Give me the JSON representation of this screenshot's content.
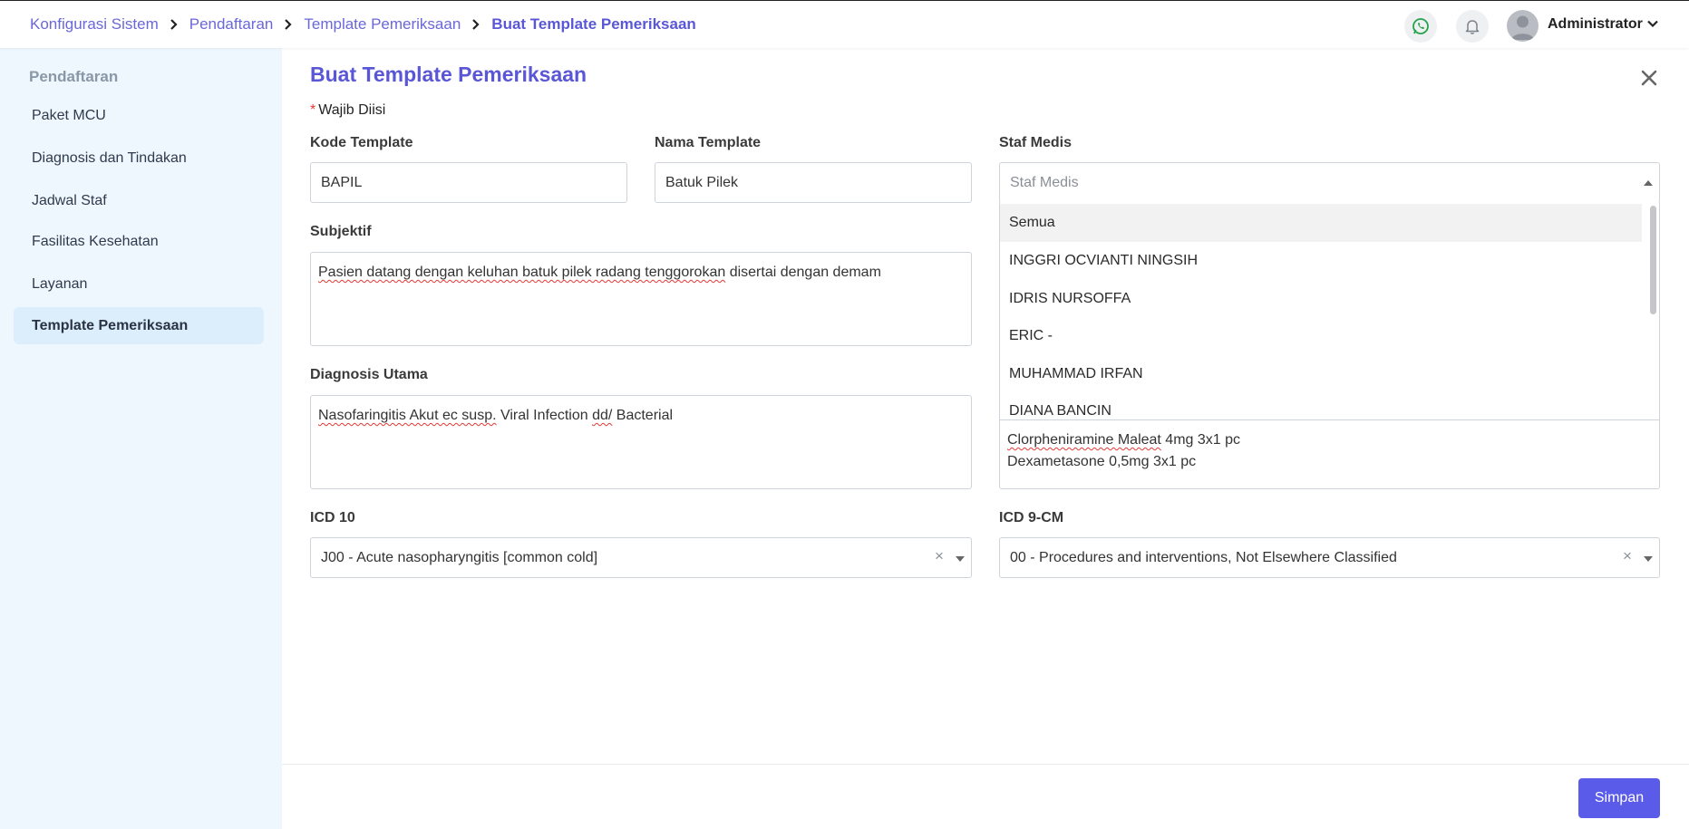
{
  "breadcrumb": [
    {
      "label": "Konfigurasi Sistem"
    },
    {
      "label": "Pendaftaran"
    },
    {
      "label": "Template Pemeriksaan"
    },
    {
      "label": "Buat Template Pemeriksaan"
    }
  ],
  "header": {
    "user_name": "Administrator",
    "whatsapp_icon": "whatsapp-icon",
    "bell_icon": "bell-icon",
    "accent_color": "#5a57d6"
  },
  "sidebar": {
    "heading": "Pendaftaran",
    "items": [
      {
        "label": "Paket MCU"
      },
      {
        "label": "Diagnosis dan Tindakan"
      },
      {
        "label": "Jadwal Staf"
      },
      {
        "label": "Fasilitas Kesehatan"
      },
      {
        "label": "Layanan"
      },
      {
        "label": "Template Pemeriksaan",
        "active": true
      }
    ]
  },
  "form": {
    "title": "Buat Template Pemeriksaan",
    "required_note": "Wajib Diisi",
    "kode_template": {
      "label": "Kode Template",
      "value": "BAPIL"
    },
    "nama_template": {
      "label": "Nama Template",
      "value": "Batuk Pilek"
    },
    "staf_medis": {
      "label": "Staf Medis",
      "placeholder": "Staf Medis",
      "options": [
        "Semua",
        "INGGRI OCVIANTI NINGSIH",
        "IDRIS NURSOFFA",
        "ERIC -",
        "MUHAMMAD IRFAN",
        "DIANA BANCIN"
      ]
    },
    "subjektif": {
      "label": "Subjektif",
      "value_marked": "Pasien datang dengan keluhan batuk pilek radang tenggorokan",
      "value_rest": " disertai dengan demam"
    },
    "diagnosis_utama": {
      "label": "Diagnosis Utama",
      "value_marked": "Nasofaringitis Akut ec susp.",
      "value_middle": " Viral Infection ",
      "value_marked2": "dd/",
      "value_rest": " Bacterial"
    },
    "terapi_lines": {
      "line1_marked": "Clorpheniramine Maleat",
      "line1_rest": " 4mg 3x1 pc",
      "line2": "Dexametasone 0,5mg 3x1 pc"
    },
    "icd10": {
      "label": "ICD 10",
      "value": "J00 - Acute nasopharyngitis [common cold]"
    },
    "icd9": {
      "label": "ICD 9-CM",
      "value": "00 - Procedures and interventions, Not Elsewhere Classified"
    },
    "clear_symbol": "×"
  },
  "footer": {
    "save_label": "Simpan",
    "save_color": "#5b5bea"
  }
}
